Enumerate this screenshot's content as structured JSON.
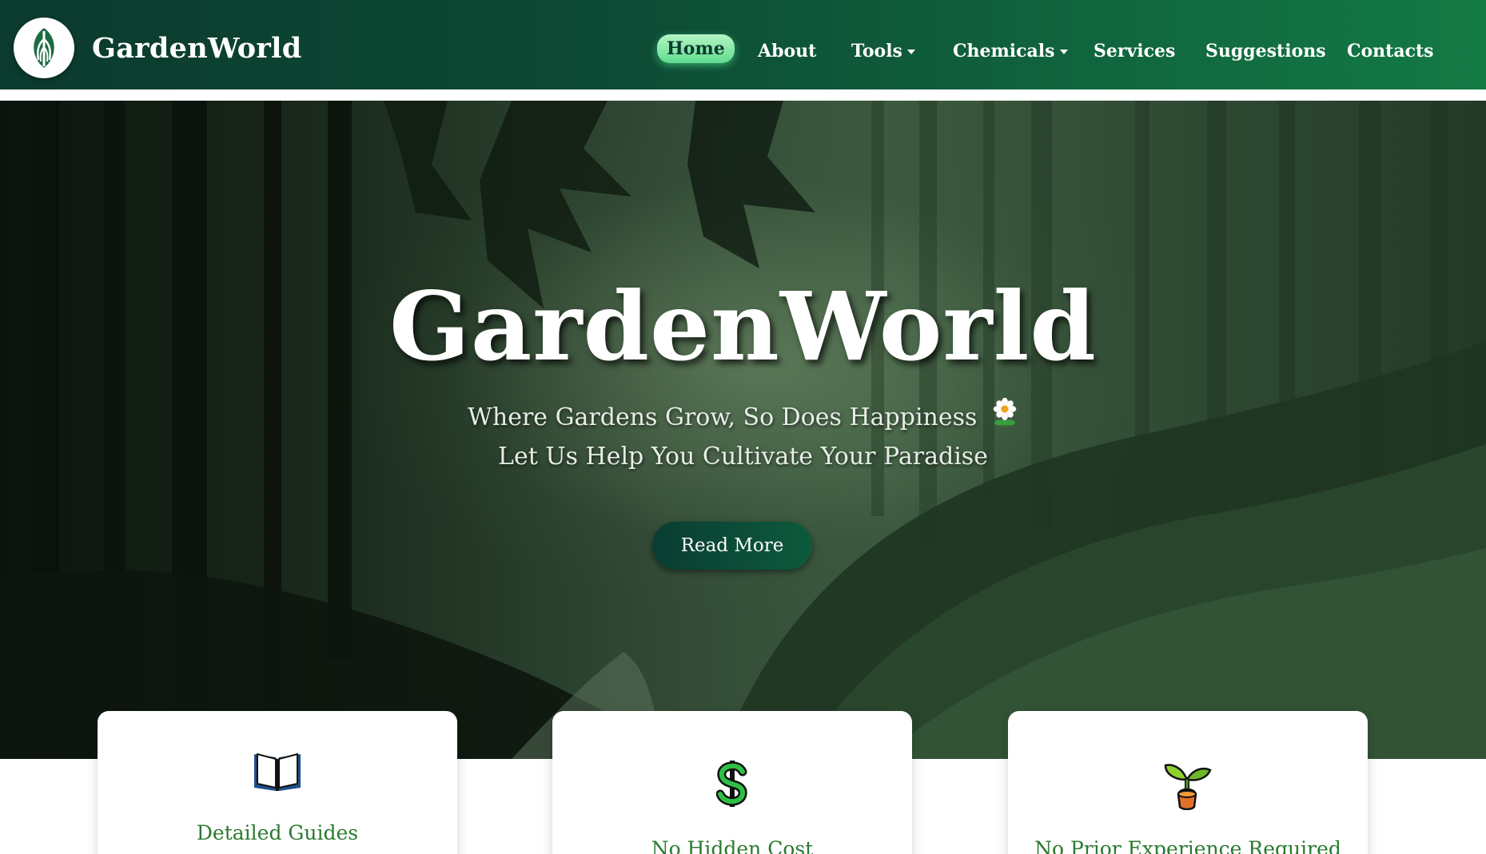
{
  "navbar": {
    "brand": "GardenWorld",
    "items": [
      {
        "label": "Home",
        "active": true
      },
      {
        "label": "About"
      },
      {
        "label": "Tools",
        "dropdown": true
      },
      {
        "label": "Chemicals",
        "dropdown": true
      },
      {
        "label": "Services"
      },
      {
        "label": "Suggestions"
      },
      {
        "label": "Contacts"
      }
    ]
  },
  "hero": {
    "title": "GardenWorld",
    "subtitle_line1": "Where Gardens Grow, So Does Happiness",
    "subtitle_line2": "Let Us Help You Cultivate Your Paradise",
    "cta_label": "Read More"
  },
  "features": [
    {
      "label": "Detailed Guides",
      "icon": "open-book-icon"
    },
    {
      "label": "No Hidden Cost",
      "icon": "dollar-sign-icon"
    },
    {
      "label": "No Prior Experience Required",
      "icon": "seedling-icon"
    }
  ],
  "colors": {
    "nav_dark": "#0b3a2e",
    "nav_light": "#137a45",
    "active_pill": "#5fdc8e",
    "feature_text": "#2a7a2f",
    "cta": "#0a3d33"
  }
}
